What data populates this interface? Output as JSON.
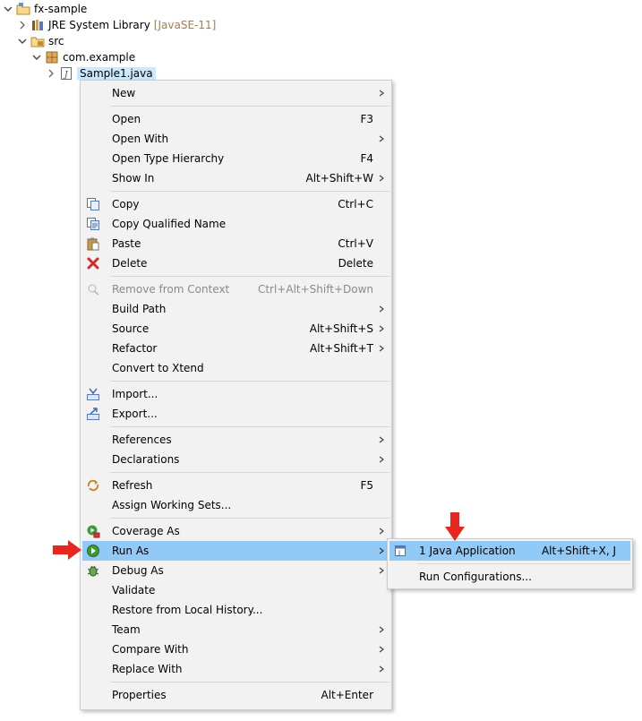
{
  "tree": {
    "project": "fx-sample",
    "jre": "JRE System Library",
    "jre_decor": "[JavaSE-11]",
    "src": "src",
    "package": "com.example",
    "file": "Sample1.java"
  },
  "context_menu": {
    "new": "New",
    "open": "Open",
    "open_acc": "F3",
    "open_with": "Open With",
    "open_type_hierarchy": "Open Type Hierarchy",
    "open_type_hierarchy_acc": "F4",
    "show_in": "Show In",
    "show_in_acc": "Alt+Shift+W",
    "copy": "Copy",
    "copy_acc": "Ctrl+C",
    "copy_qualified": "Copy Qualified Name",
    "paste": "Paste",
    "paste_acc": "Ctrl+V",
    "delete": "Delete",
    "delete_acc": "Delete",
    "remove_context": "Remove from Context",
    "remove_context_acc": "Ctrl+Alt+Shift+Down",
    "build_path": "Build Path",
    "source": "Source",
    "source_acc": "Alt+Shift+S",
    "refactor": "Refactor",
    "refactor_acc": "Alt+Shift+T",
    "convert_xtend": "Convert to Xtend",
    "import": "Import...",
    "export": "Export...",
    "references": "References",
    "declarations": "Declarations",
    "refresh": "Refresh",
    "refresh_acc": "F5",
    "assign_working_sets": "Assign Working Sets...",
    "coverage_as": "Coverage As",
    "run_as": "Run As",
    "debug_as": "Debug As",
    "validate": "Validate",
    "restore_history": "Restore from Local History...",
    "team": "Team",
    "compare_with": "Compare With",
    "replace_with": "Replace With",
    "properties": "Properties",
    "properties_acc": "Alt+Enter"
  },
  "submenu": {
    "java_app": "1 Java Application",
    "java_app_acc": "Alt+Shift+X, J",
    "run_configs": "Run Configurations..."
  },
  "colors": {
    "menu_bg": "#f2f2f2",
    "highlight": "#91c9f7",
    "annotation_arrow": "#e8261f"
  }
}
